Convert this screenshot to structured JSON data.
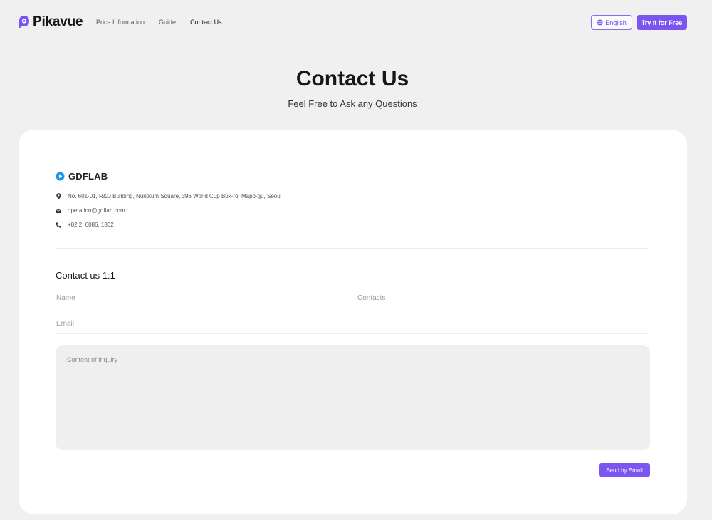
{
  "brand": {
    "name": "Pikavue",
    "color": "#7b55ef",
    "logo_icon": "pikavue-logo-icon"
  },
  "nav": {
    "links": [
      {
        "label": "Price Information"
      },
      {
        "label": "Guide"
      },
      {
        "label": "Contact Us",
        "active": true
      }
    ],
    "language_label": "English",
    "language_icon": "globe-icon",
    "cta_label": "Try It for Free"
  },
  "hero": {
    "title": "Contact Us",
    "subtitle": "Feel Free to Ask any Questions"
  },
  "company": {
    "name": "GDFLAB",
    "logo_icon": "play-icon",
    "address": "No. 601-01, R&D Building, Nuritkum Square, 396 World Cup Buk-ro, Mapo-gu, Seoul",
    "email": "operation@gdflab.com",
    "phone": "+82 2. 6086. 1862"
  },
  "form": {
    "title": "Contact us 1:1",
    "name_placeholder": "Name",
    "contacts_placeholder": "Contacts",
    "email_placeholder": "Email",
    "content_placeholder": "Content of Inquiry",
    "submit_label": "Send by Email"
  }
}
